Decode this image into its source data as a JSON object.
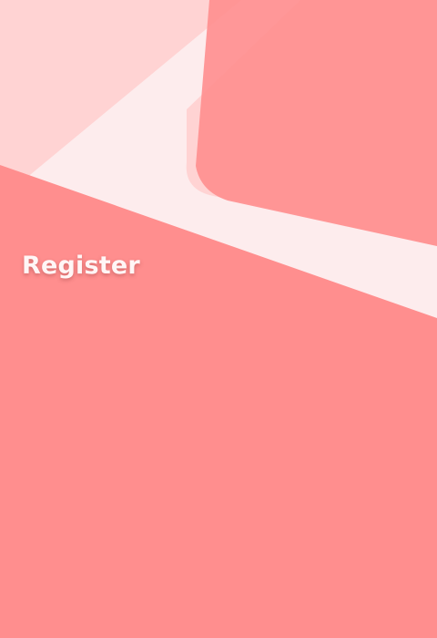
{
  "page": {
    "title": "Register"
  },
  "theme": {
    "background": "#fdeced",
    "primary": "#ff8e8e",
    "soft_pink": "#ffd3d3",
    "pale_pink": "#fdeced",
    "title_color": "#fff6f6"
  }
}
